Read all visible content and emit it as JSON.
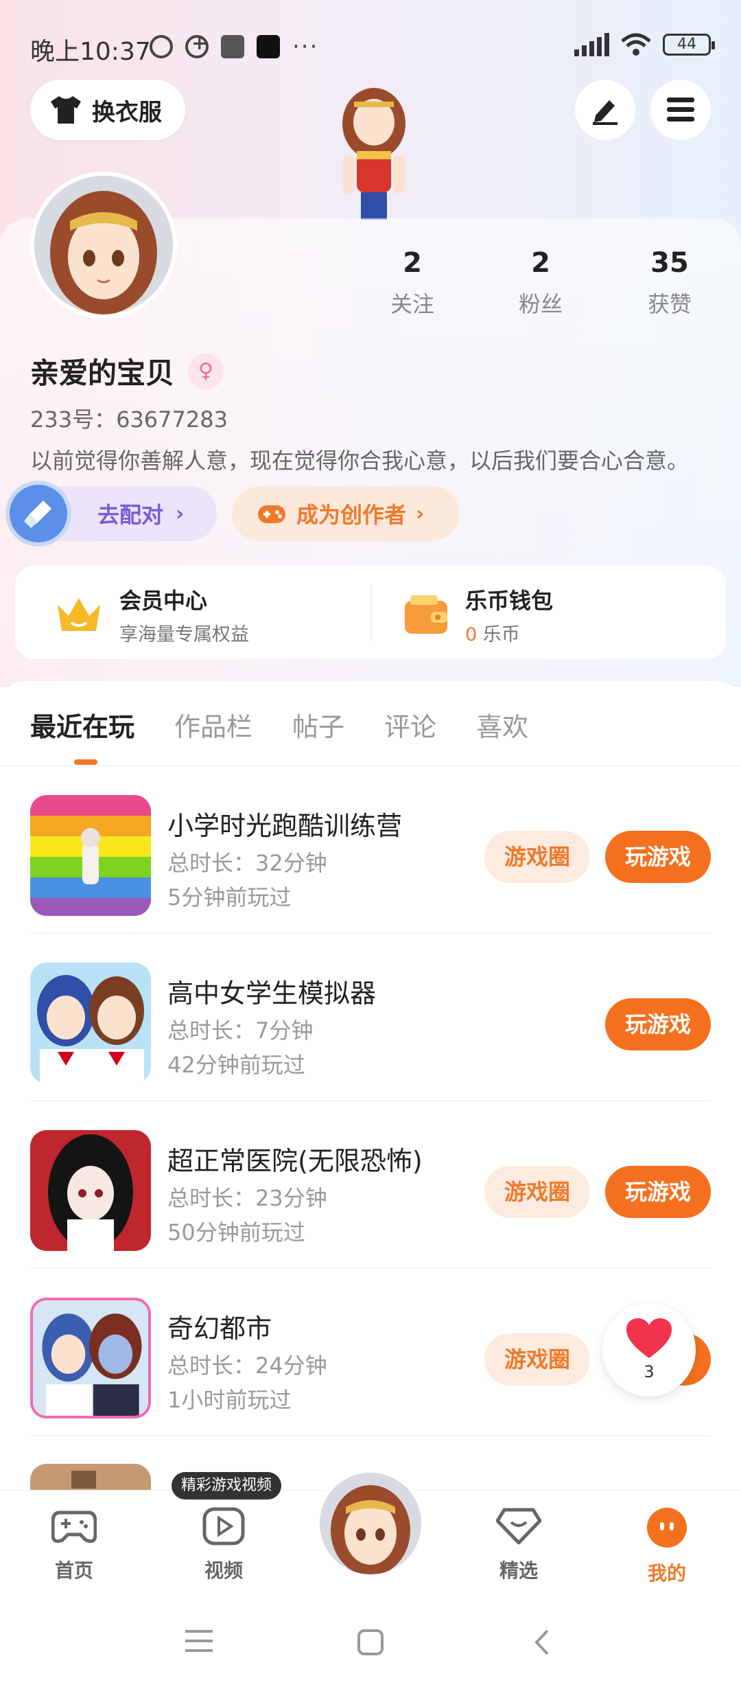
{
  "status_bar": {
    "time": "晚上10:37",
    "battery": "44"
  },
  "header": {
    "outfit_label": "换衣服"
  },
  "profile": {
    "nickname": "亲爱的宝贝",
    "uid": "233号：63677283",
    "bio": "以前觉得你善解人意，现在觉得你合我心意，以后我们要合心合意。",
    "stats": [
      {
        "value": "2",
        "label": "关注"
      },
      {
        "value": "2",
        "label": "粉丝"
      },
      {
        "value": "35",
        "label": "获赞"
      }
    ],
    "match_label": "去配对",
    "creator_label": "成为创作者"
  },
  "wallet_card": {
    "vip_title": "会员中心",
    "vip_sub": "享海量专属权益",
    "wallet_title": "乐币钱包",
    "wallet_amount": "0",
    "wallet_unit": "乐币"
  },
  "tabs": [
    "最近在玩",
    "作品栏",
    "帖子",
    "评论",
    "喜欢"
  ],
  "games": [
    {
      "title": "小学时光跑酷训练营",
      "duration": "总时长：32分钟",
      "last_played": "5分钟前玩过",
      "circle_label": "游戏圈",
      "play_label": "玩游戏"
    },
    {
      "title": "高中女学生模拟器",
      "duration": "总时长：7分钟",
      "last_played": "42分钟前玩过",
      "play_label": "玩游戏"
    },
    {
      "title": "超正常医院(无限恐怖)",
      "duration": "总时长：23分钟",
      "last_played": "50分钟前玩过",
      "circle_label": "游戏圈",
      "play_label": "玩游戏"
    },
    {
      "title": "奇幻都市",
      "duration": "总时长：24分钟",
      "last_played": "1小时前玩过",
      "circle_label": "游戏圈"
    }
  ],
  "like_float": {
    "count": "3"
  },
  "bottom_nav": {
    "video_tip": "精彩游戏视频",
    "items": [
      "首页",
      "视频",
      "精选",
      "我的"
    ]
  },
  "colors": {
    "accent": "#f5701e",
    "purple": "#7a5bd6"
  }
}
